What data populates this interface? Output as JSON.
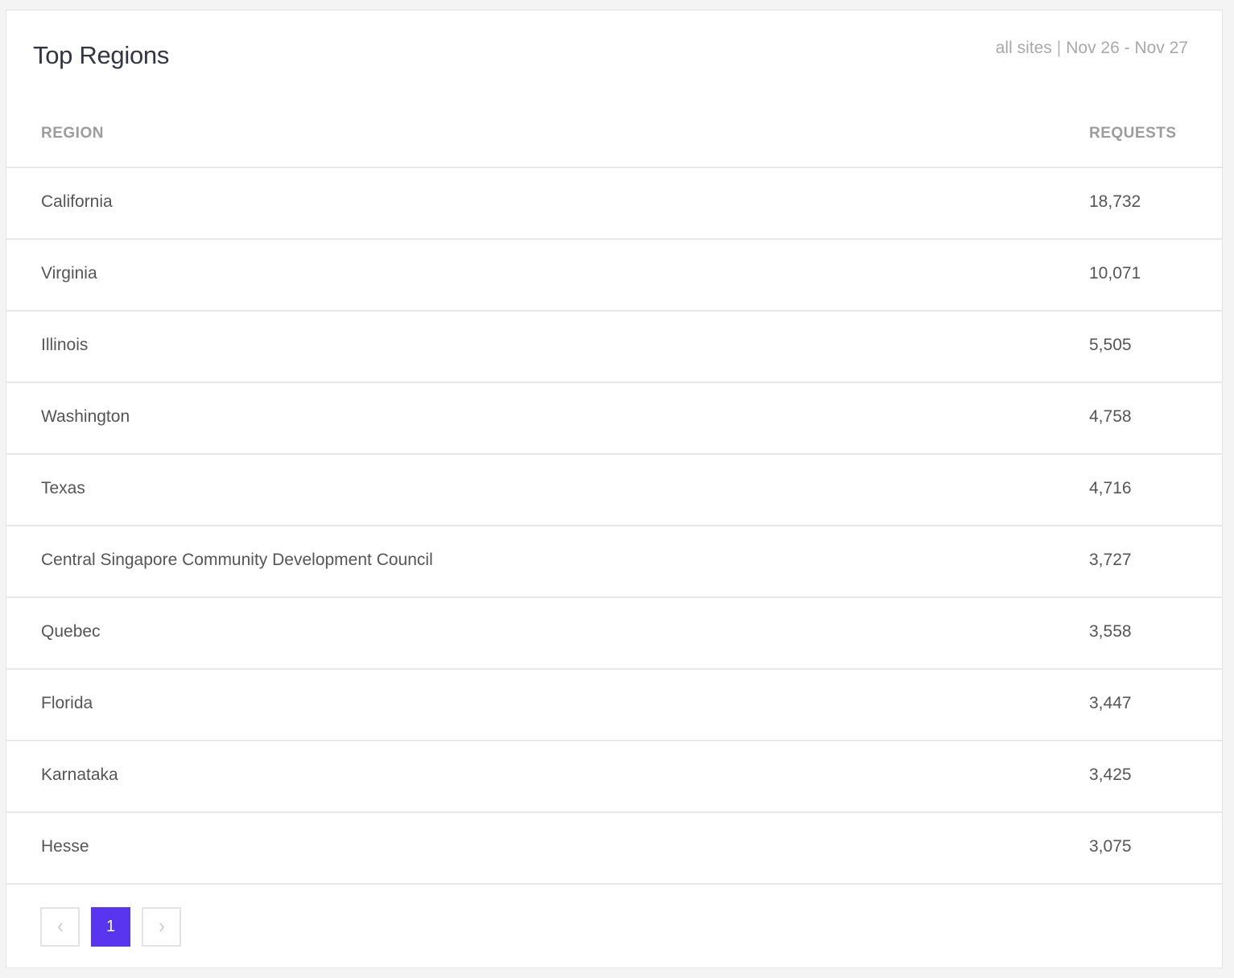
{
  "card": {
    "title": "Top Regions",
    "scope": "all sites",
    "separator": "|",
    "date_range": "Nov 26 - Nov 27"
  },
  "table": {
    "columns": [
      "REGION",
      "REQUESTS"
    ],
    "rows": [
      {
        "region": "California",
        "requests": "18,732"
      },
      {
        "region": "Virginia",
        "requests": "10,071"
      },
      {
        "region": "Illinois",
        "requests": "5,505"
      },
      {
        "region": "Washington",
        "requests": "4,758"
      },
      {
        "region": "Texas",
        "requests": "4,716"
      },
      {
        "region": "Central Singapore Community Development Council",
        "requests": "3,727"
      },
      {
        "region": "Quebec",
        "requests": "3,558"
      },
      {
        "region": "Florida",
        "requests": "3,447"
      },
      {
        "region": "Karnataka",
        "requests": "3,425"
      },
      {
        "region": "Hesse",
        "requests": "3,075"
      }
    ]
  },
  "pagination": {
    "current_page": "1",
    "prev_icon": "chevron-left-icon",
    "next_icon": "chevron-right-icon",
    "accent_color": "#5a35f0"
  }
}
